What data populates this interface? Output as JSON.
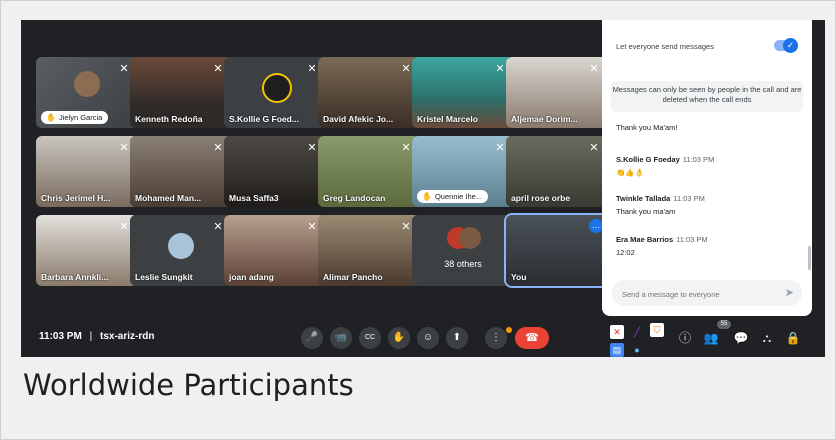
{
  "caption": "Worldwide Participants",
  "meeting": {
    "time": "11:03 PM",
    "separator": "|",
    "code": "tsx-ariz-rdn"
  },
  "tiles": [
    {
      "name": "Jielyn Garcia",
      "pill": true
    },
    {
      "name": "Kenneth Redoña"
    },
    {
      "name": "S.Kollie G Foed..."
    },
    {
      "name": "David Afekic Jo..."
    },
    {
      "name": "Kristel Marcelo"
    },
    {
      "name": "Aljemae Dorim..."
    },
    {
      "name": "Chris Jerimel H..."
    },
    {
      "name": "Mohamed Man..."
    },
    {
      "name": "Musa Saffa3"
    },
    {
      "name": "Greg Landocan"
    },
    {
      "name": "Quennie Ihe...",
      "pill": true
    },
    {
      "name": "april rose orbe"
    },
    {
      "name": "Barbara Annkli..."
    },
    {
      "name": "Leslie Sungkit"
    },
    {
      "name": "joan adang"
    },
    {
      "name": "Alimar Pancho"
    },
    {
      "name": "38 others"
    },
    {
      "name": "You"
    }
  ],
  "chat": {
    "toggle_label": "Let everyone send messages",
    "notice": "Messages can only be seen by people in the call and are deleted when the call ends",
    "partial_text": "Thank you Ma'am!",
    "messages": [
      {
        "sender": "S.Kollie G Foeday",
        "time": "11:03 PM",
        "text": "👏👍👌"
      },
      {
        "sender": "Twinkle Tallada",
        "time": "11:03 PM",
        "text": "Thank you ma'am"
      },
      {
        "sender": "Era Mae Barrios",
        "time": "11:03 PM",
        "text": "12:02"
      }
    ],
    "input_placeholder": "Send a message to everyone"
  },
  "people_count": "55",
  "icons": {
    "mic": "🎤",
    "camera": "📹",
    "cc": "CC",
    "hand": "✋",
    "emoji": "☺",
    "present": "⬆",
    "more": "⋮",
    "leave": "☎",
    "info": "ⓘ",
    "people": "👥",
    "chat": "💬",
    "activities": "⛬",
    "lock": "🔒",
    "send": "➤",
    "muted": "🔇"
  },
  "colors": {
    "accent": "#1a73e8",
    "leave": "#ea4335",
    "tile_bg": "#3c4043",
    "bg": "#202124"
  }
}
